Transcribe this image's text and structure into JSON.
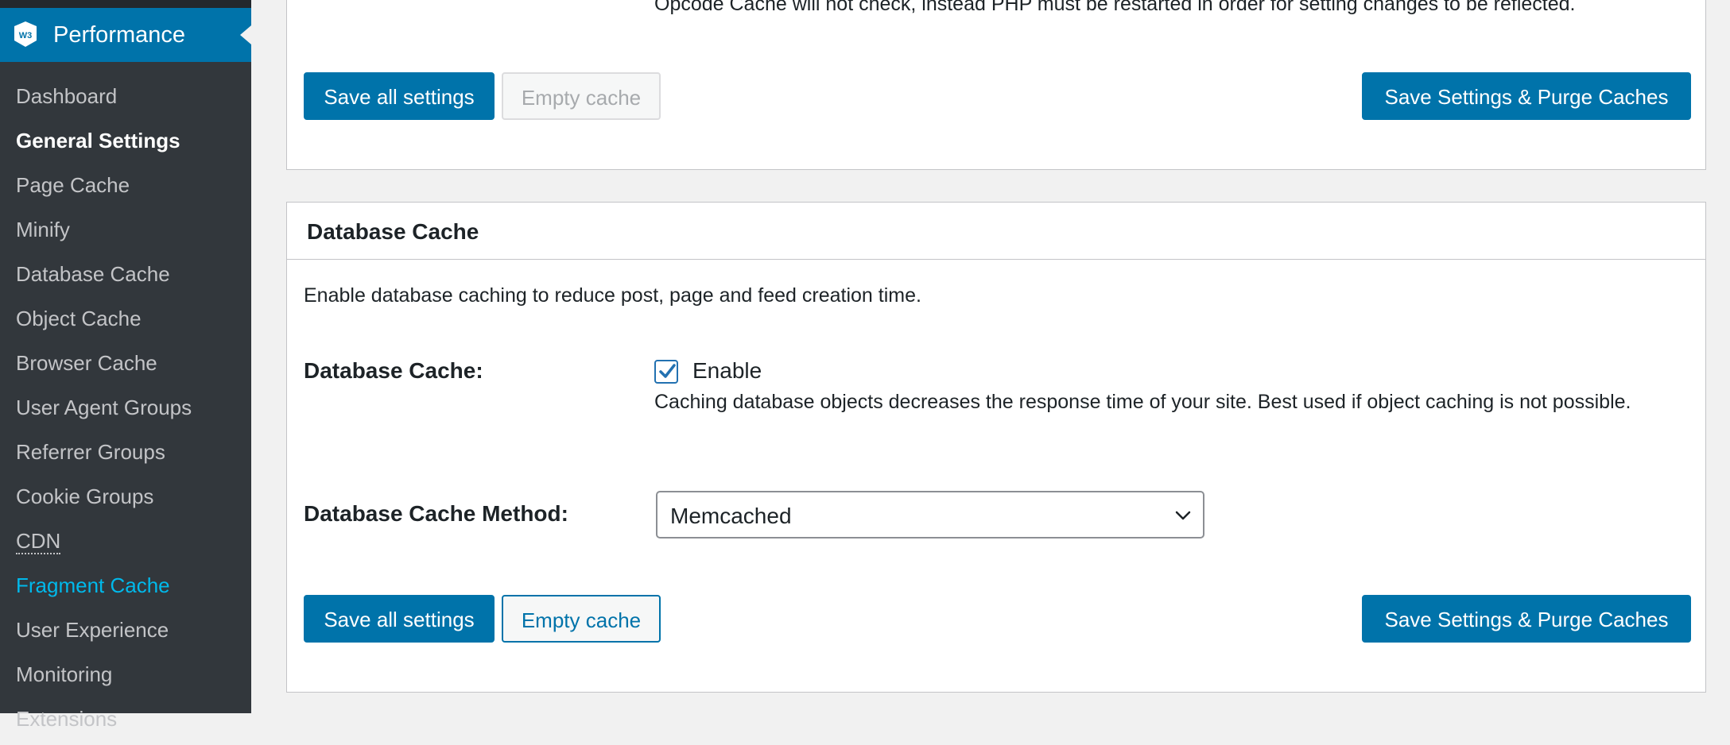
{
  "sidebar": {
    "menu_title": "Performance",
    "logo_text": "W3",
    "items": [
      {
        "label": "Dashboard"
      },
      {
        "label": "General Settings"
      },
      {
        "label": "Page Cache"
      },
      {
        "label": "Minify"
      },
      {
        "label": "Database Cache"
      },
      {
        "label": "Object Cache"
      },
      {
        "label": "Browser Cache"
      },
      {
        "label": "User Agent Groups"
      },
      {
        "label": "Referrer Groups"
      },
      {
        "label": "Cookie Groups"
      },
      {
        "label": "CDN"
      },
      {
        "label": "Fragment Cache"
      },
      {
        "label": "User Experience"
      },
      {
        "label": "Monitoring"
      },
      {
        "label": "Extensions"
      }
    ],
    "current_item": "General Settings",
    "highlight_item": "Fragment Cache"
  },
  "top_panel": {
    "clipped_text": "Opcode Cache will not check, instead PHP must be restarted in order for setting changes to be reflected.",
    "save_all_label": "Save all settings",
    "empty_cache_label": "Empty cache",
    "save_purge_label": "Save Settings & Purge Caches"
  },
  "db_panel": {
    "title": "Database Cache",
    "description": "Enable database caching to reduce post, page and feed creation time.",
    "cache_label": "Database Cache:",
    "enable_label": "Enable",
    "enabled": true,
    "help_text": "Caching database objects decreases the response time of your site. Best used if object caching is not possible.",
    "method_label": "Database Cache Method:",
    "method_value": "Memcached",
    "save_all_label": "Save all settings",
    "empty_cache_label": "Empty cache",
    "save_purge_label": "Save Settings & Purge Caches"
  },
  "colors": {
    "sidebar_bg": "#32373c",
    "accent": "#0073aa",
    "highlight": "#00b9eb"
  }
}
